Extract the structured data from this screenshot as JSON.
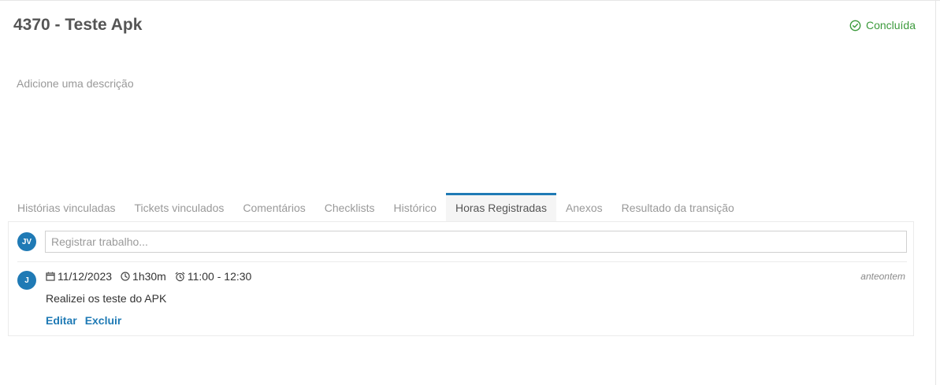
{
  "header": {
    "title": "4370 - Teste Apk",
    "status": {
      "label": "Concluída",
      "icon": "check-circle-icon",
      "color": "#3c9a3c"
    }
  },
  "description_placeholder": "Adicione uma descrição",
  "tabs": [
    {
      "label": "Histórias vinculadas",
      "active": false
    },
    {
      "label": "Tickets vinculados",
      "active": false
    },
    {
      "label": "Comentários",
      "active": false
    },
    {
      "label": "Checklists",
      "active": false
    },
    {
      "label": "Histórico",
      "active": false
    },
    {
      "label": "Horas Registradas",
      "active": true
    },
    {
      "label": "Anexos",
      "active": false
    },
    {
      "label": "Resultado da transição",
      "active": false
    }
  ],
  "work_log": {
    "current_user_initials": "JV",
    "input_placeholder": "Registrar trabalho...",
    "input_value": "",
    "entries": [
      {
        "user_initials": "J",
        "date": "11/12/2023",
        "duration": "1h30m",
        "time_range": "11:00 - 12:30",
        "relative_time": "anteontem",
        "text": "Realizei os teste do APK",
        "edit_label": "Editar",
        "delete_label": "Excluir"
      }
    ]
  },
  "colors": {
    "accent": "#1f7ab5",
    "success": "#3c9a3c",
    "muted_text": "#999999"
  }
}
